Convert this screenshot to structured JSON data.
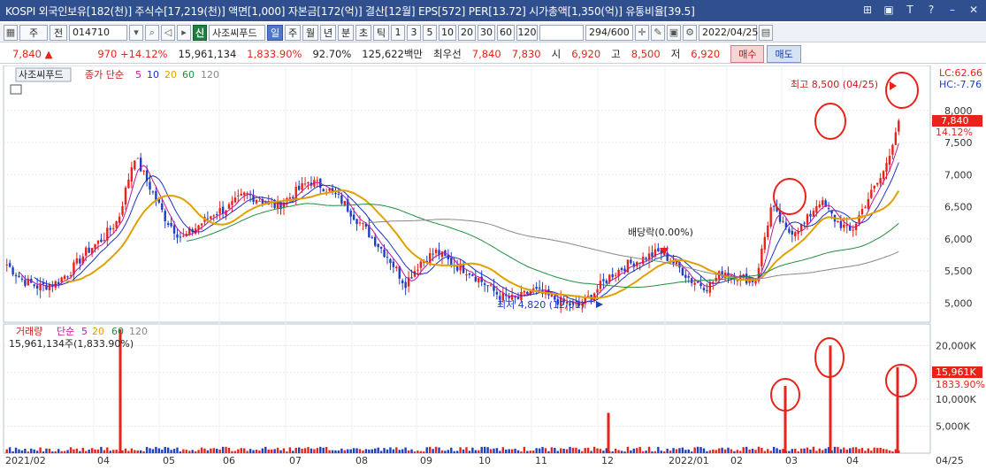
{
  "title": "KOSPI 외국인보유[182(천)] 주식수[17,219(천)] 액면[1,000] 자본금[172(억)] 결산[12월] EPS[572] PER[13.72] 시가총액[1,350(억)] 유통비율[39.5]",
  "window_icons": [
    "⊞",
    "▣",
    "T",
    "?",
    "–",
    "✕"
  ],
  "toolbar": {
    "type": "주",
    "scope": "전",
    "code": "014710",
    "stock_badge": "신",
    "stock_name": "사조씨푸드",
    "periods": [
      "일",
      "주",
      "월",
      "년",
      "분",
      "초",
      "틱"
    ],
    "intervals": [
      "1",
      "3",
      "5",
      "10",
      "20",
      "30",
      "60",
      "120"
    ],
    "count": "294/600",
    "date": "2022/04/25"
  },
  "info": {
    "price": "7,840",
    "change": "970 +14.12%",
    "volume": "15,961,134",
    "vol_ratio": "1,833.90%",
    "ratio2": "92.70%",
    "amount": "125,622백만",
    "pref_label": "최우선",
    "best_ask": "7,840",
    "best_bid": "7,830",
    "open_label": "시",
    "open": "6,920",
    "high_label": "고",
    "high": "8,500",
    "low_label": "저",
    "low": "6,920",
    "buy": "매수",
    "sell": "매도"
  },
  "price_panel": {
    "title": "사조씨푸드",
    "legend": [
      "종가 단순",
      "5",
      "10",
      "20",
      "60",
      "120"
    ],
    "lc": "LC:62.66",
    "hc": "HC:-7.76",
    "max_label": "최고 8,500 (04/25)",
    "min_label": "최저 4,820 (12/01)",
    "div_label": "배당락(0.00%)",
    "last_price": "7,840",
    "last_change": "14.12%"
  },
  "volume_panel": {
    "legend_title": "거래량",
    "legend": [
      "단순",
      "5",
      "20",
      "60",
      "120"
    ],
    "sub": "15,961,134주(1,833.90%)",
    "last_volume": "15,961K",
    "last_ratio": "1833.90%"
  },
  "chart_data": {
    "type": "candlestick",
    "price_axis": {
      "ticks": [
        5000,
        5500,
        6000,
        6500,
        7000,
        7500,
        8000
      ],
      "range": [
        4700,
        8700
      ]
    },
    "volume_axis": {
      "ticks": [
        "5,000K",
        "10,000K",
        "15,000K",
        "20,000K"
      ],
      "values": [
        5000,
        10000,
        15000,
        20000
      ],
      "range": [
        0,
        24000
      ]
    },
    "x_labels": [
      "2021/02",
      "04",
      "05",
      "06",
      "07",
      "08",
      "09",
      "10",
      "11",
      "12",
      "2022/01",
      "02",
      "03",
      "04",
      "04/25"
    ],
    "close_path": [
      5600,
      5350,
      5250,
      5300,
      5500,
      5800,
      6000,
      6300,
      7300,
      6800,
      6300,
      6000,
      6200,
      6400,
      6500,
      6700,
      6600,
      6500,
      6700,
      6900,
      6800,
      6600,
      6300,
      6000,
      5700,
      5300,
      5650,
      5800,
      5600,
      5500,
      5300,
      5100,
      5050,
      5200,
      5100,
      5000,
      4950,
      5200,
      5450,
      5600,
      5700,
      5800,
      5600,
      5350,
      5250,
      5500,
      5400,
      5350,
      6500,
      6100,
      6200,
      6600,
      6300,
      6100,
      6600,
      7000,
      7840
    ],
    "volume_spikes_k": [
      {
        "x": "2021/04",
        "v": 23000
      },
      {
        "x": "2021/12",
        "v": 7500
      },
      {
        "x": "2022/03",
        "v": 12500
      },
      {
        "x": "2022/04a",
        "v": 20000
      },
      {
        "x": "2022/04/25",
        "v": 15961
      }
    ]
  }
}
